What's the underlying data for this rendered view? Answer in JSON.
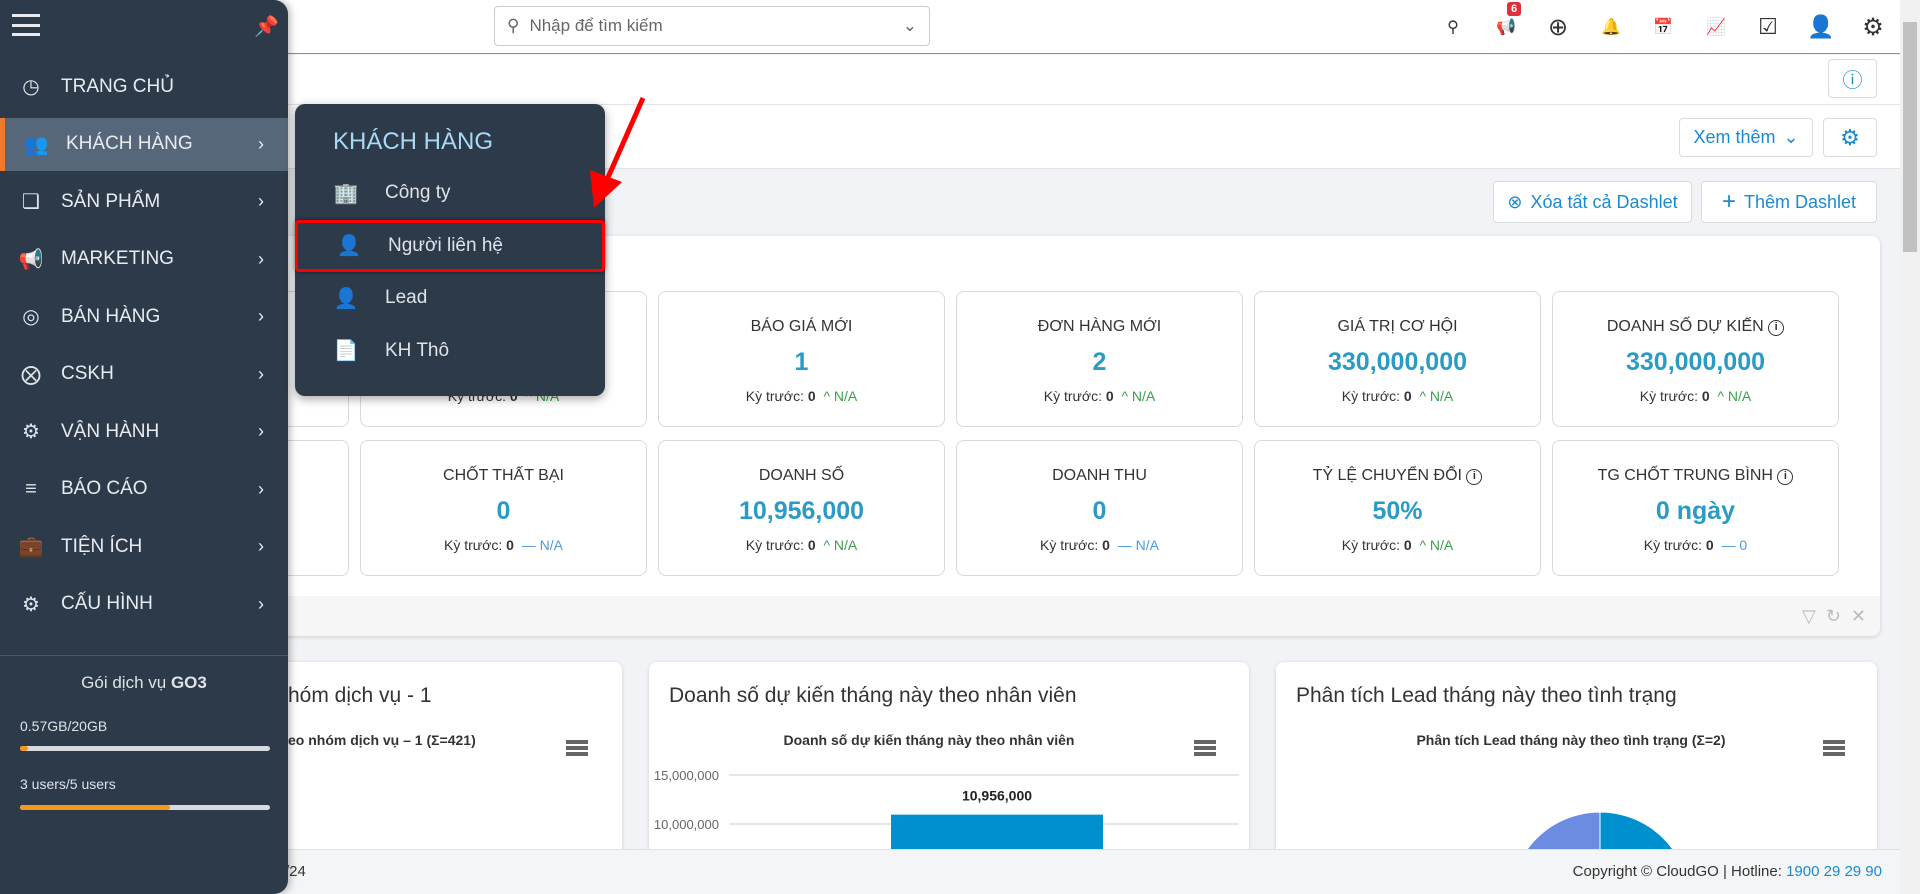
{
  "search": {
    "placeholder": "Nhập để tìm kiếm"
  },
  "topbar": {
    "icons": [
      "map-pin-question-icon",
      "megaphone-icon",
      "plus-circle-icon",
      "bell-icon",
      "calendar-icon",
      "chart-icon",
      "checkbox-icon",
      "user-icon",
      "gear-icon"
    ],
    "notification_count": "6"
  },
  "toolbar": {
    "xem_them": "Xem thêm",
    "xoa_dashlet": "Xóa tất cả Dashlet",
    "them_dashlet": "Thêm Dashlet"
  },
  "sidebar": {
    "items": [
      {
        "label": "TRANG CHỦ",
        "icon": "dashboard-icon"
      },
      {
        "label": "KHÁCH HÀNG",
        "icon": "users-icon",
        "active": true
      },
      {
        "label": "SẢN PHẨM",
        "icon": "boxes-icon"
      },
      {
        "label": "MARKETING",
        "icon": "megaphone-icon"
      },
      {
        "label": "BÁN HÀNG",
        "icon": "target-icon"
      },
      {
        "label": "CSKH",
        "icon": "lifebuoy-icon"
      },
      {
        "label": "VẬN HÀNH",
        "icon": "cogs-icon"
      },
      {
        "label": "BÁO CÁO",
        "icon": "report-icon"
      },
      {
        "label": "TIỆN ÍCH",
        "icon": "toolbox-icon"
      },
      {
        "label": "CẤU HÌNH",
        "icon": "gear-icon"
      }
    ],
    "plan_label": "Gói dịch vụ",
    "plan_name": "GO3",
    "storage": "0.57GB/20GB",
    "storage_fraction": 0.0285,
    "users": "3 users/5 users",
    "users_fraction": 0.6,
    "accent": "#f0782c"
  },
  "popup": {
    "title": "KHÁCH HÀNG",
    "items": [
      {
        "label": "Công ty",
        "icon": "building-icon"
      },
      {
        "label": "Người liên hệ",
        "icon": "contact-person-icon",
        "highlighted": true
      },
      {
        "label": "Lead",
        "icon": "person-icon"
      },
      {
        "label": "KH Thô",
        "icon": "contact-file-icon"
      }
    ]
  },
  "kpis": [
    [
      {
        "title": "",
        "value": "",
        "prev_label": "",
        "prev": "",
        "trend": "",
        "change": ""
      },
      {
        "title": "",
        "value": "",
        "prev_label": "Kỳ trước:",
        "prev": "0",
        "trend": "up",
        "change": "N/A"
      },
      {
        "title": "BÁO GIÁ MỚI",
        "value": "1",
        "prev_label": "Kỳ trước:",
        "prev": "0",
        "trend": "up",
        "change": "N/A"
      },
      {
        "title": "ĐƠN HÀNG MỚI",
        "value": "2",
        "prev_label": "Kỳ trước:",
        "prev": "0",
        "trend": "up",
        "change": "N/A"
      },
      {
        "title": "GIÁ TRỊ CƠ HỘI",
        "value": "330,000,000",
        "prev_label": "Kỳ trước:",
        "prev": "0",
        "trend": "up",
        "change": "N/A"
      },
      {
        "title": "DOANH SỐ DỰ KIẾN",
        "info": true,
        "value": "330,000,000",
        "prev_label": "Kỳ trước:",
        "prev": "0",
        "trend": "up",
        "change": "N/A"
      }
    ],
    [
      {
        "title": "",
        "value": "",
        "prev_label": "",
        "prev": "",
        "trend": "",
        "change": ""
      },
      {
        "title": "CHỐT THẤT BẠI",
        "value": "0",
        "prev_label": "Kỳ trước:",
        "prev": "0",
        "trend": "flat",
        "change": "N/A"
      },
      {
        "title": "DOANH SỐ",
        "value": "10,956,000",
        "prev_label": "Kỳ trước:",
        "prev": "0",
        "trend": "up",
        "change": "N/A"
      },
      {
        "title": "DOANH THU",
        "value": "0",
        "prev_label": "Kỳ trước:",
        "prev": "0",
        "trend": "flat",
        "change": "N/A"
      },
      {
        "title": "TỶ LỆ CHUYỂN ĐỔI",
        "info": true,
        "value": "50%",
        "prev_label": "Kỳ trước:",
        "prev": "0",
        "trend": "up",
        "change": "N/A"
      },
      {
        "title": "TG CHỐT TRUNG BÌNH",
        "info": true,
        "value": "0 ngày",
        "prev_label": "Kỳ trước:",
        "prev": "0",
        "trend": "flat",
        "change": "0"
      }
    ]
  ],
  "charts": {
    "c1": {
      "heading": "hóm dịch vụ - 1",
      "subtitle": "eo nhóm dịch vụ – 1 (Σ=421)"
    },
    "c2": {
      "heading": "Doanh số dự kiến tháng này theo nhân viên",
      "subtitle": "Doanh số dự kiến tháng này theo nhân viên"
    },
    "c3": {
      "heading": "Phân tích Lead tháng này theo tình trạng",
      "subtitle": "Phân tích Lead tháng này theo tình trạng (Σ=2)"
    }
  },
  "chart_data": [
    {
      "type": "bar",
      "title": "Doanh số dự kiến tháng này theo nhân viên",
      "yticks": [
        "10,000,000",
        "15,000,000"
      ],
      "values": [
        10956000
      ],
      "data_labels": [
        "10,956,000"
      ],
      "color": "#0090d0"
    },
    {
      "type": "pie",
      "title": "Phân tích Lead tháng này theo tình trạng (Σ=2)",
      "values": [
        1,
        1
      ],
      "colors": [
        "#6b8ce0",
        "#0090d0"
      ]
    }
  ],
  "footer": {
    "left": "/24",
    "copyright": "Copyright © CloudGO",
    "hotline_label": "Hotline:",
    "hotline": "1900 29 29 90"
  }
}
